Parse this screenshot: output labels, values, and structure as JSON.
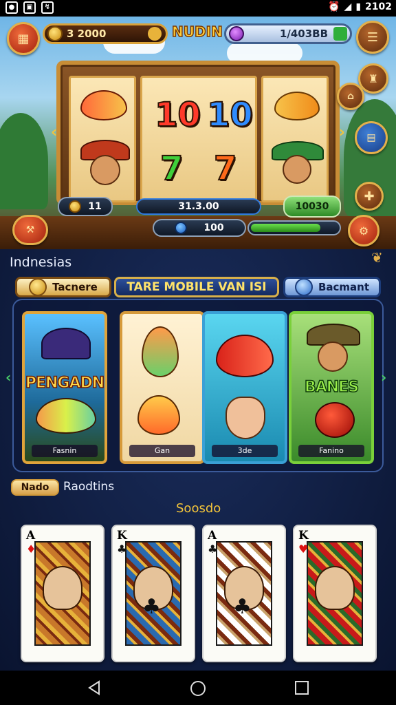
{
  "status_bar": {
    "left_icons": [
      "notification-icon-1",
      "notification-icon-2",
      "notification-icon-3"
    ],
    "right_icons": [
      "alarm-icon",
      "wifi-icon",
      "signal-icon",
      "battery-icon"
    ],
    "time": "2102"
  },
  "top_bar": {
    "coins": "3 2000",
    "brand": "NUDIN",
    "gems": "1/403BB"
  },
  "slot": {
    "reel_center_top": [
      "10",
      "10"
    ],
    "reel_center_bottom": [
      "7",
      "7"
    ],
    "bet_left": "11",
    "win_amount": "31.3.00",
    "spin_label": "10030",
    "balance": "100"
  },
  "side_buttons": [
    "menu-icon",
    "trophy-icon",
    "shop-icon",
    "code-icon",
    "plus-icon",
    "settings-icon"
  ],
  "lower": {
    "region_title": "Indnesias",
    "tabs": [
      {
        "label": "Tacnere",
        "icon": "coin-icon"
      },
      {
        "label": "TARE MOBILE VAN ISI",
        "icon": ""
      },
      {
        "label": "Bacmant",
        "icon": "search-icon"
      }
    ],
    "games": [
      {
        "title": "PENGADN",
        "caption": "Fasnin",
        "theme": "fish-wizard"
      },
      {
        "title": "",
        "caption": "Gan",
        "theme": "golden-fish"
      },
      {
        "title": "",
        "caption": "3de",
        "theme": "fishing-girl"
      },
      {
        "title": "BANES",
        "caption": "Fanino",
        "theme": "farmer-girl"
      }
    ],
    "badge": "Nado",
    "section2": "Raodtins",
    "cards_title": "Soosdo",
    "cards": [
      {
        "rank": "A",
        "suit": "♦",
        "color": "#d11"
      },
      {
        "rank": "K",
        "suit": "♣",
        "color": "#111"
      },
      {
        "rank": "A",
        "suit": "♣",
        "color": "#111"
      },
      {
        "rank": "K",
        "suit": "♥",
        "color": "#d11"
      }
    ]
  },
  "nav": {
    "back": "back-icon",
    "home": "home-icon",
    "recents": "recents-icon"
  },
  "colors": {
    "accent_gold": "#d9a23a",
    "panel_navy": "#0c1630",
    "green": "#2d8a25"
  }
}
